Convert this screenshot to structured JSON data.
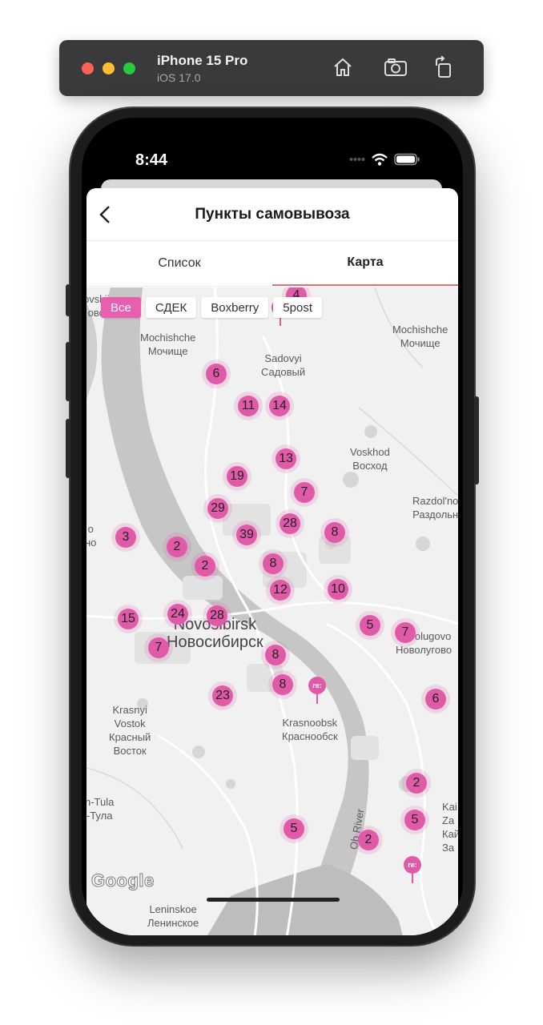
{
  "simulator": {
    "device": "iPhone 15 Pro",
    "os": "iOS 17.0"
  },
  "status_bar": {
    "time": "8:44"
  },
  "header": {
    "title": "Пункты самовывоза"
  },
  "tabs": [
    {
      "label": "Список",
      "active": false
    },
    {
      "label": "Карта",
      "active": true
    }
  ],
  "filters": [
    {
      "label": "Все",
      "active": true
    },
    {
      "label": "СДЕК",
      "active": false
    },
    {
      "label": "Boxberry",
      "active": false
    },
    {
      "label": "5post",
      "active": false
    }
  ],
  "places": {
    "mochishche_w": [
      "Mochishche",
      "Мочище"
    ],
    "mochishche_e": [
      "Mochishche",
      "Мочище"
    ],
    "sadovyi": [
      "Sadovyi",
      "Садовый"
    ],
    "voskhod": [
      "Voskhod",
      "Восход"
    ],
    "razdolnoe": [
      "Razdol'no",
      "Раздольн"
    ],
    "novosibirsk": [
      "Novosibirsk",
      "Новосибирск"
    ],
    "novolugovoe": [
      "Novolugovo",
      "Новолугово"
    ],
    "krasnyi_vostok": [
      "Krasnyi",
      "Vostok",
      "Красный",
      "Восток"
    ],
    "krasnoobsk": [
      "Krasnoobsk",
      "Краснообск"
    ],
    "tula": [
      "h-Tula",
      "-Тула"
    ],
    "leninskoe": [
      "Leninskoe",
      "Ленинское"
    ],
    "ob_river": "Ob River",
    "left_edge_top": [
      "ovskii",
      "ово"
    ],
    "left_edge_mid": [
      "o",
      "но"
    ],
    "right_edge_bottom": [
      "Kai",
      "Za",
      "Кай",
      "За"
    ]
  },
  "clusters": [
    "4",
    "6",
    "11",
    "14",
    "13",
    "19",
    "7",
    "29",
    "28",
    "8",
    "39",
    "3",
    "2",
    "2",
    "8",
    "12",
    "10",
    "15",
    "24",
    "28",
    "5",
    "7",
    "7",
    "8",
    "8",
    "23",
    "6",
    "2",
    "5",
    "5",
    "2"
  ],
  "pins": [
    "re:",
    "re:",
    ""
  ],
  "attribution": "Google",
  "colors": {
    "accent": "#e05aa8",
    "tab_underline": "#e8716f"
  }
}
